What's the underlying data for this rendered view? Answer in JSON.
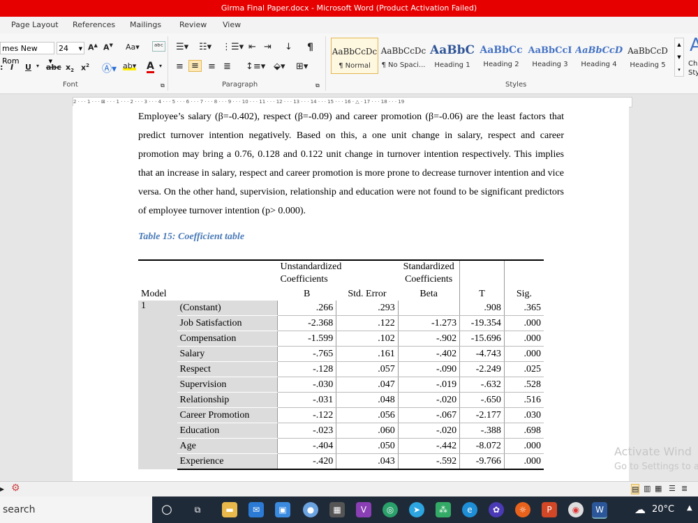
{
  "window": {
    "title": "Girma Final Paper.docx  -  Microsoft Word (Product Activation Failed)"
  },
  "ribbon_tabs": [
    "Page Layout",
    "References",
    "Mailings",
    "Review",
    "View"
  ],
  "font_group": {
    "font_name": "mes New Rom",
    "font_size": "24",
    "label": "Font"
  },
  "paragraph_group": {
    "label": "Paragraph"
  },
  "styles_group": {
    "label": "Styles",
    "items": [
      {
        "sample": "AaBbCcDc",
        "name": "¶ Normal",
        "color": "#222222"
      },
      {
        "sample": "AaBbCcDc",
        "name": "¶ No Spaci...",
        "color": "#222222"
      },
      {
        "sample": "AaBbC",
        "name": "Heading 1",
        "color": "#2f5597"
      },
      {
        "sample": "AaBbCc",
        "name": "Heading 2",
        "color": "#4472c4"
      },
      {
        "sample": "AaBbCcI",
        "name": "Heading 3",
        "color": "#4472c4"
      },
      {
        "sample": "AaBbCcD",
        "name": "Heading 4",
        "color": "#4472c4"
      },
      {
        "sample": "AaBbCcD",
        "name": "Heading 5",
        "color": "#222222"
      }
    ],
    "change_label_1": "Ch",
    "change_label_2": "Sty"
  },
  "ruler": {
    "text": "2 · · · 1 · · · ⊠ · · · 1 · · · 2 · · · 3 · · · 4 · · · 5 · · · 6 · · · 7 · · · 8 · · · 9 · · · 10 · · · 11 · · · 12 · · · 13 · · · 14 · · · 15 · · · 16 · △ · 17 · · · 18 · · · 19"
  },
  "document": {
    "paragraph": "Employee’s salary (β=-0.402), respect (β=-0.09) and career promotion (β=-0.06) are the least factors that predict turnover intention negatively. Based on this, a one unit change in salary, respect and career promotion may bring a 0.76, 0.128 and 0.122 unit change in turnover intention respectively. This implies that an increase in salary, respect and career promotion is more prone to decrease turnover intention and vice versa. On the other hand, supervision, relationship and education were not found to be significant predictors of employee turnover intention (p> 0.000).",
    "table_caption": "Table 15: Coefficient table"
  },
  "coef_table": {
    "header_unstd_1": "Unstandardized",
    "header_unstd_2": "Coefficients",
    "header_std_1": "Standardized",
    "header_std_2": "Coefficients",
    "col_model": "Model",
    "col_b": "B",
    "col_se": "Std. Error",
    "col_beta": "Beta",
    "col_t": "T",
    "col_sig": "Sig.",
    "model_number": "1",
    "rows": [
      [
        "(Constant)",
        ".266",
        ".293",
        "",
        ".908",
        ".365"
      ],
      [
        "Job Satisfaction",
        "-2.368",
        ".122",
        "-1.273",
        "-19.354",
        ".000"
      ],
      [
        "Compensation",
        "-1.599",
        ".102",
        "-.902",
        "-15.696",
        ".000"
      ],
      [
        "Salary",
        "-.765",
        ".161",
        "-.402",
        "-4.743",
        ".000"
      ],
      [
        "Respect",
        "-.128",
        ".057",
        "-.090",
        "-2.249",
        ".025"
      ],
      [
        "Supervision",
        "-.030",
        ".047",
        "-.019",
        "-.632",
        ".528"
      ],
      [
        "Relationship",
        "-.031",
        ".048",
        "-.020",
        "-.650",
        ".516"
      ],
      [
        "Career Promotion",
        "-.122",
        ".056",
        "-.067",
        "-2.177",
        ".030"
      ],
      [
        "Education",
        "-.023",
        ".060",
        "-.020",
        "-.388",
        ".698"
      ],
      [
        "Age",
        "-.404",
        ".050",
        "-.442",
        "-8.072",
        ".000"
      ],
      [
        "Experience",
        "-.420",
        ".043",
        "-.592",
        "-9.766",
        ".000"
      ]
    ]
  },
  "watermark": {
    "line1": "Activate Wind",
    "line2": "Go to Settings to a"
  },
  "taskbar": {
    "search_placeholder": "search",
    "temperature": "20°C"
  },
  "colors": {
    "title_bar": "#e60000",
    "caption": "#4a7ab8",
    "taskbar": "#1f2a38"
  }
}
